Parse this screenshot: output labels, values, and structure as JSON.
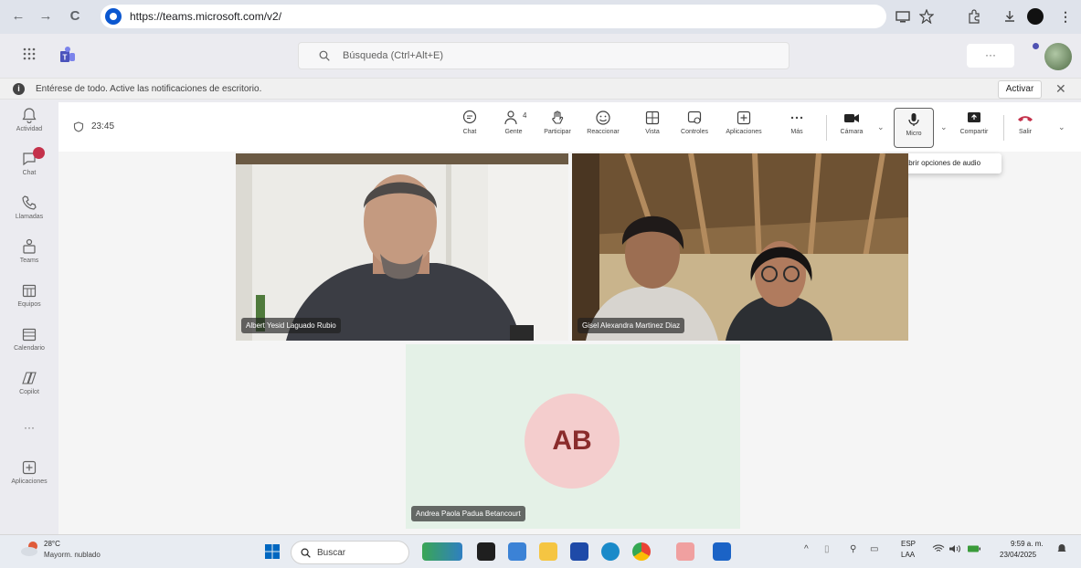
{
  "browser": {
    "url": "https://teams.microsoft.com/v2/",
    "back_glyph": "←",
    "forward_glyph": "→",
    "reload_glyph": "C"
  },
  "teams_header": {
    "search_placeholder": "Búsqueda (Ctrl+Alt+E)",
    "more_label": "···"
  },
  "banner": {
    "icon_glyph": "i",
    "text": "Entérese de todo. Active las notificaciones de escritorio.",
    "action_label": "Activar",
    "close_glyph": "✕"
  },
  "left_rail": {
    "items": [
      {
        "label": "Actividad",
        "icon": "bell-icon"
      },
      {
        "label": "Chat",
        "icon": "chat-icon"
      },
      {
        "label": "Llamadas",
        "icon": "phone-icon"
      },
      {
        "label": "Teams",
        "icon": "teams-icon"
      },
      {
        "label": "Equipos",
        "icon": "calendar-grid-icon"
      },
      {
        "label": "Calendario",
        "icon": "calendar-icon"
      },
      {
        "label": "Copilot",
        "icon": "copilot-icon"
      },
      {
        "label": "···",
        "icon": "more-icon"
      },
      {
        "label": "Aplicaciones",
        "icon": "apps-add-icon"
      }
    ]
  },
  "meeting": {
    "timer": "23:45",
    "toolbar": {
      "chat": "Chat",
      "people": "Gente",
      "people_count": "4",
      "raise": "Participar",
      "react": "Reaccionar",
      "view": "Vista",
      "controls": "Controles",
      "apps": "Aplicaciones",
      "more": "Más",
      "camera": "Cámara",
      "mic": "Micro",
      "share": "Compartir",
      "leave": "Salir"
    },
    "tooltip": "Abrir opciones de audio",
    "participants": [
      {
        "name": "Albert Yesid Laguado Rubio"
      },
      {
        "name": "Gisel Alexandra Martinez Diaz"
      },
      {
        "name": "Andrea Paola Padua Betancourt",
        "initials": "AB"
      }
    ]
  },
  "taskbar": {
    "weather_temp": "28°C",
    "weather_desc": "Mayorm. nublado",
    "search_placeholder": "Buscar",
    "lang_top": "ESP",
    "lang_bottom": "LAA",
    "time": "9:59 a. m.",
    "date": "23/04/2025"
  }
}
